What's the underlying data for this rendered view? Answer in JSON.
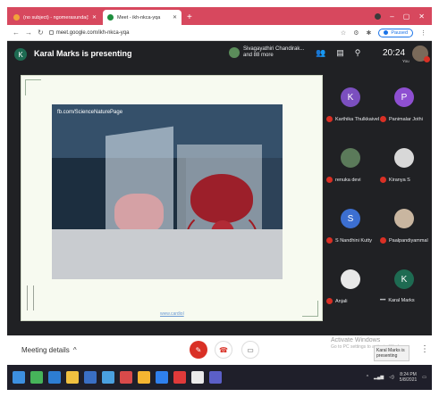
{
  "browser": {
    "tabs": [
      {
        "label": "(no subject) - ngomerasunda(S3)",
        "active": false
      },
      {
        "label": "Meet - ikh-nkca-yqa",
        "active": true
      }
    ],
    "new_tab_icon": "plus-icon",
    "url": "meet.google.com/ikh-nkca-yqa",
    "paused_label": "Paused"
  },
  "meet": {
    "presenter_initial": "K",
    "presenting_text": "Karal Marks is presenting",
    "participants_summary_line1": "Sivagayathiri Chandirak...",
    "participants_summary_line2": "and 88 more",
    "clock": "20:24",
    "self_label": "You",
    "slide": {
      "watermark": "fb.com/ScienceNaturePage",
      "footer_link": "www.cardiol"
    },
    "participants": [
      {
        "initial": "K",
        "name": "Karthika Thulkkaivel",
        "color": "#7b4fbf",
        "muted": true
      },
      {
        "initial": "P",
        "name": "Panimalar Jothi",
        "color": "#8e4fd1",
        "muted": true
      },
      {
        "initial": "",
        "name": "renuka devi",
        "color": "#5b7a5a",
        "muted": true
      },
      {
        "initial": "",
        "name": "Kiranya S",
        "color": "#d8d8d8",
        "muted": true
      },
      {
        "initial": "S",
        "name": "S Nandhini Kutty",
        "color": "#3c6fd1",
        "muted": true
      },
      {
        "initial": "",
        "name": "Paalpandiyammal",
        "color": "#c9b6a0",
        "muted": true
      },
      {
        "initial": "",
        "name": "Anjali",
        "color": "#e8e8e8",
        "muted": true
      },
      {
        "initial": "K",
        "name": "Karal Marks",
        "color": "#1e6b52",
        "muted": false
      }
    ]
  },
  "controls": {
    "meeting_details": "Meeting details",
    "activate_title": "Activate Windows",
    "activate_sub": "Go to PC settings to activate Windows.",
    "tooltip": "Karal Marks is presenting"
  },
  "taskbar": {
    "time": "8:24 PM",
    "date": "5/8/2021"
  }
}
